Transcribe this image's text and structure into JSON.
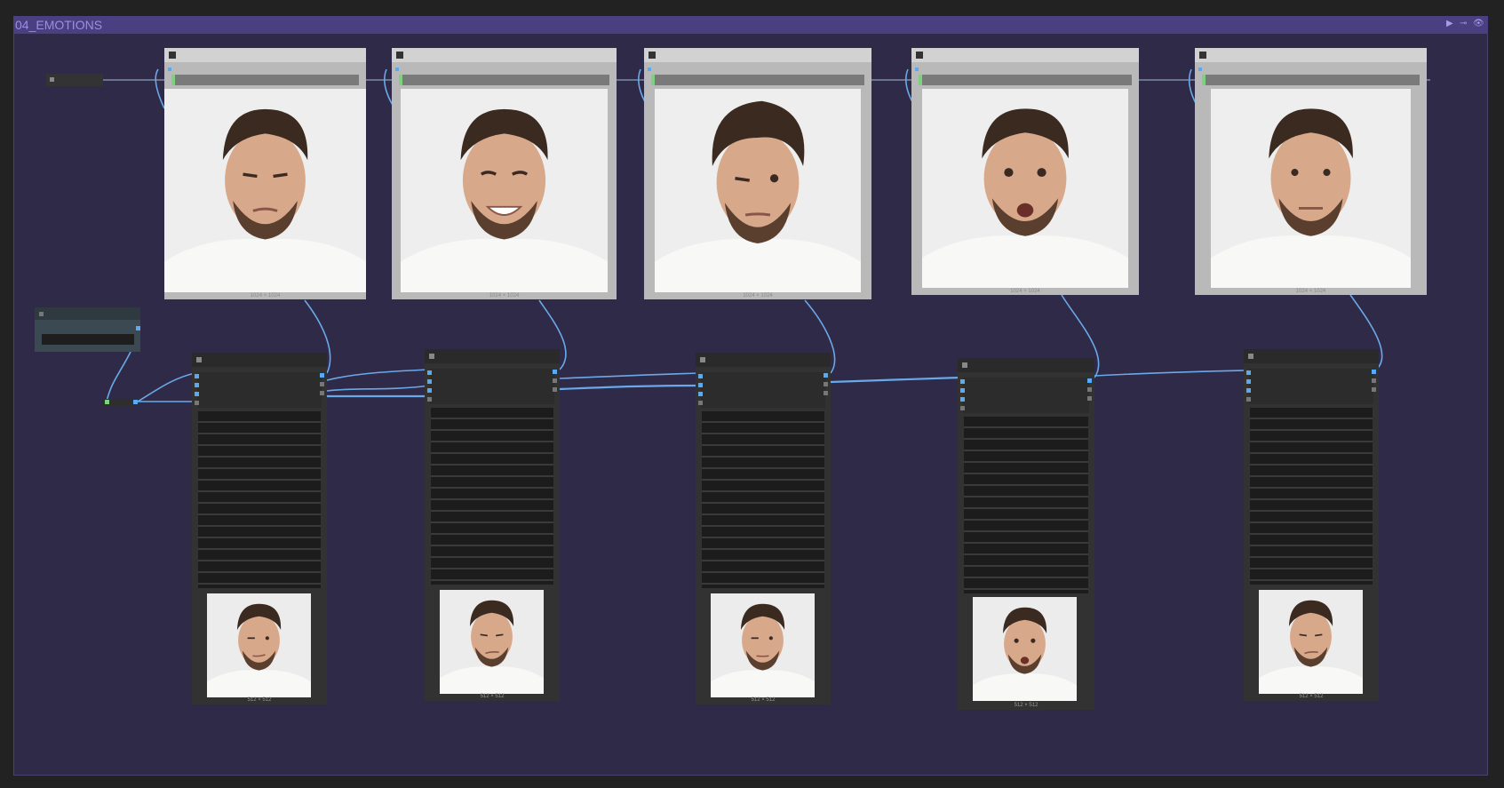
{
  "group": {
    "title": "04_EMOTIONS",
    "controls": [
      "▶",
      "⊸",
      "👁"
    ]
  },
  "previews": [
    {
      "expression": "squint",
      "size_label": "1024 × 1024"
    },
    {
      "expression": "smile",
      "size_label": "1024 × 1024"
    },
    {
      "expression": "wink",
      "size_label": "1024 × 1024"
    },
    {
      "expression": "surprise",
      "size_label": "1024 × 1024"
    },
    {
      "expression": "neutral",
      "size_label": "1024 × 1024"
    }
  ],
  "outputs": [
    {
      "expression": "wink",
      "size_label": "512 × 512"
    },
    {
      "expression": "smirk",
      "size_label": "512 × 512"
    },
    {
      "expression": "wink",
      "size_label": "512 × 512"
    },
    {
      "expression": "surprise",
      "size_label": "512 × 512"
    },
    {
      "expression": "smirk",
      "size_label": "512 × 512"
    }
  ],
  "colors": {
    "wire": "#6aa9e9",
    "group_bg": "#2f2a47",
    "group_header": "#4a3f80",
    "title": "#9d8fe0"
  }
}
